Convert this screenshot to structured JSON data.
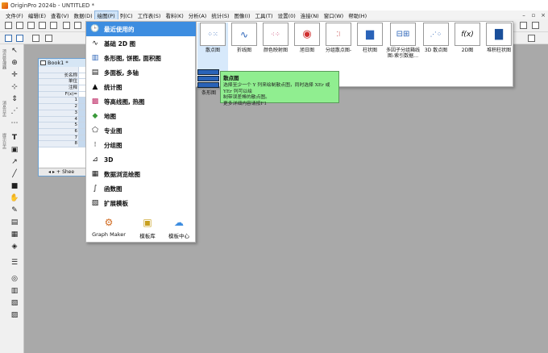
{
  "window": {
    "title": "OriginPro 2024b - UNTITLED *"
  },
  "menubar": {
    "items": [
      "文件(F)",
      "编辑(E)",
      "查看(V)",
      "数据(D)",
      "绘图(P)",
      "列(C)",
      "工作表(S)",
      "看料(K)",
      "分析(A)",
      "统计(S)",
      "图像(I)",
      "工具(T)",
      "设置(0)",
      "连接(N)",
      "窗口(W)",
      "帮助(H)"
    ],
    "active_index": 4
  },
  "left_labels": [
    "项目管理器",
    "消息日志",
    "提示日志"
  ],
  "workbook": {
    "title": "Book1 *",
    "row_headers": [
      "长名称",
      "单位",
      "注释",
      "F(x)="
    ],
    "row_numbers": [
      "1",
      "2",
      "3",
      "4",
      "5",
      "6",
      "7",
      "8"
    ],
    "sheet_tab": "Shee"
  },
  "plot_menu": {
    "categories": [
      {
        "label": "最近使用的",
        "icon": "recent-icon"
      },
      {
        "label": "基础 2D 图",
        "icon": "basic-2d-icon"
      },
      {
        "label": "条形图, 饼图, 面积图",
        "icon": "bar-pie-area-icon"
      },
      {
        "label": "多面板, 多轴",
        "icon": "multi-panel-icon"
      },
      {
        "label": "统计图",
        "icon": "statistics-icon"
      },
      {
        "label": "等高线图, 热图",
        "icon": "contour-heatmap-icon"
      },
      {
        "label": "地图",
        "icon": "map-icon"
      },
      {
        "label": "专业图",
        "icon": "specialized-icon"
      },
      {
        "label": "分组图",
        "icon": "grouped-icon"
      },
      {
        "label": "3D",
        "icon": "3d-icon"
      },
      {
        "label": "数据浏览绘图",
        "icon": "data-explore-icon"
      },
      {
        "label": "函数图",
        "icon": "function-icon"
      },
      {
        "label": "扩展模板",
        "icon": "extension-icon"
      }
    ],
    "active_index": 0,
    "bottom_buttons": [
      {
        "label": "Graph Maker",
        "icon": "graph-maker-icon"
      },
      {
        "label": "模板库",
        "icon": "template-library-icon"
      },
      {
        "label": "模板中心",
        "icon": "template-center-icon"
      }
    ]
  },
  "gallery": {
    "tiles": [
      {
        "label": "散点图",
        "icon": "scatter-thumb-icon"
      },
      {
        "label": "折线图",
        "icon": "line-thumb-icon"
      },
      {
        "label": "颜色映射图",
        "icon": "colormap-thumb-icon"
      },
      {
        "label": "旭日图",
        "icon": "sunburst-thumb-icon"
      },
      {
        "label": "分组散点图-",
        "icon": "grouped-scatter-thumb-icon"
      },
      {
        "label": "柱状图",
        "icon": "column-thumb-icon"
      },
      {
        "label": "多因子分组箱线图-索引数据…",
        "icon": "multifactor-box-thumb-icon"
      },
      {
        "label": "3D 散点图",
        "icon": "3d-scatter-thumb-icon"
      },
      {
        "label": "2D图",
        "icon": "2d-function-thumb-icon"
      },
      {
        "label": "堆积柱状图",
        "icon": "stacked-column-thumb-icon"
      }
    ],
    "selected_index": 0,
    "sub_label": "条形图"
  },
  "tooltip": {
    "title": "散点图",
    "lines": [
      "选择至少一个 Y 列来绘制散点图，同时选择 XEr 或 YEr 列可以绘",
      "制带误差棒的散点图。",
      "更多详细内容请按F1"
    ]
  }
}
